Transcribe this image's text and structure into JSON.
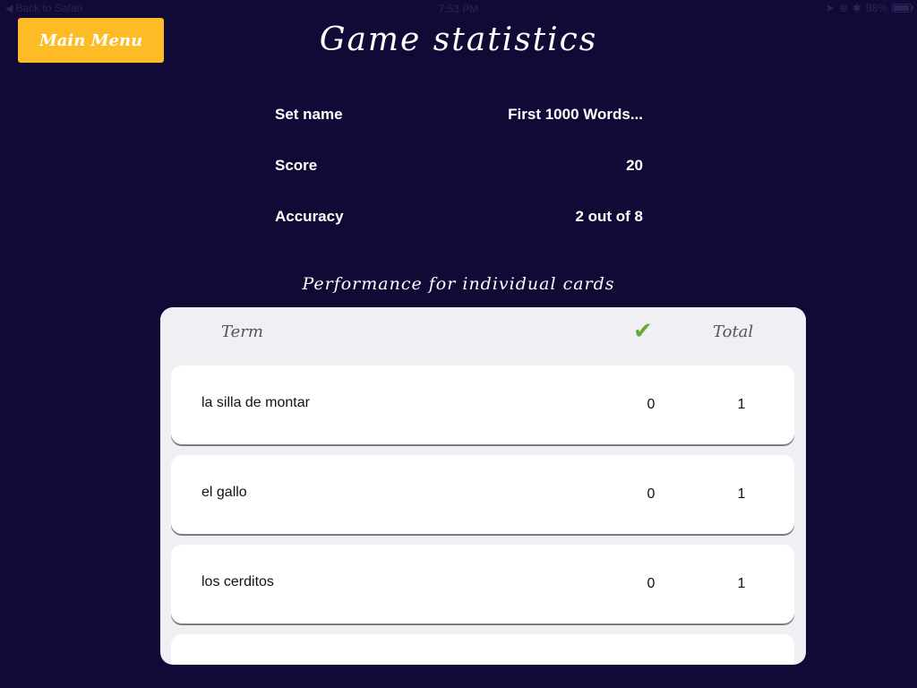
{
  "status_bar": {
    "back_label": "Back to Safari",
    "time": "7:53 PM",
    "battery": "98%"
  },
  "header": {
    "main_menu_label": "Main Menu",
    "title": "Game statistics"
  },
  "stats": [
    {
      "label": "Set name",
      "value": "First 1000 Words..."
    },
    {
      "label": "Score",
      "value": "20"
    },
    {
      "label": "Accuracy",
      "value": "2 out of 8"
    }
  ],
  "performance": {
    "heading": "Performance for individual cards",
    "columns": {
      "term": "Term",
      "correct_icon": "check-icon",
      "total": "Total"
    },
    "rows": [
      {
        "term": "la silla de montar",
        "correct": "0",
        "total": "1"
      },
      {
        "term": "el gallo",
        "correct": "0",
        "total": "1"
      },
      {
        "term": "los cerditos",
        "correct": "0",
        "total": "1"
      }
    ]
  },
  "colors": {
    "background": "#120a36",
    "accent": "#fdbb26",
    "check": "#6aa83a",
    "panel": "#efeff4"
  }
}
